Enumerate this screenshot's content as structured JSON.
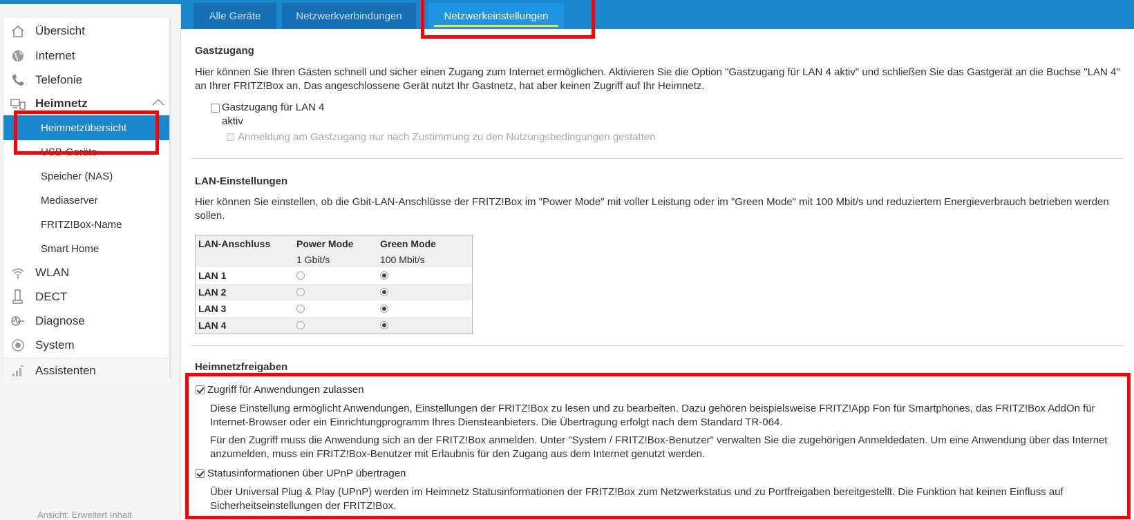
{
  "sidebar": {
    "items": [
      {
        "label": "Übersicht",
        "icon": "home-icon"
      },
      {
        "label": "Internet",
        "icon": "globe-icon"
      },
      {
        "label": "Telefonie",
        "icon": "phone-icon"
      },
      {
        "label": "Heimnetz",
        "icon": "network-icon"
      },
      {
        "label": "WLAN",
        "icon": "wifi-icon"
      },
      {
        "label": "DECT",
        "icon": "dect-phone-icon"
      },
      {
        "label": "Diagnose",
        "icon": "diagnose-icon"
      },
      {
        "label": "System",
        "icon": "system-icon"
      },
      {
        "label": "Assistenten",
        "icon": "wizard-icon"
      }
    ],
    "subitems": [
      "Heimnetzübersicht",
      "USB-Geräte",
      "Speicher (NAS)",
      "Mediaserver",
      "FRITZ!Box-Name",
      "Smart Home"
    ],
    "footer": "Ansicht: Erweitert   Inhalt"
  },
  "tabs": [
    "Alle Geräte",
    "Netzwerkverbindungen",
    "Netzwerkeinstellungen"
  ],
  "guest": {
    "title": "Gastzugang",
    "text": "Hier können Sie Ihren Gästen schnell und sicher einen Zugang zum Internet ermöglichen. Aktivieren Sie die Option \"Gastzugang für LAN 4 aktiv\" und schließen Sie das Gastgerät an die Buchse \"LAN 4\" an Ihrer FRITZ!Box an. Das angeschlossene Gerät nutzt Ihr Gastnetz, hat aber keinen Zugriff auf Ihr Heimnetz.",
    "cb1_line1": "Gastzugang für LAN 4",
    "cb1_line2": "aktiv",
    "cb2": "Anmeldung am Gastzugang nur nach Zustimmung zu den Nutzungsbedingungen gestatten"
  },
  "lan": {
    "title": "LAN-Einstellungen",
    "text": "Hier können Sie einstellen, ob die Gbit-LAN-Anschlüsse der FRITZ!Box im \"Power Mode\" mit voller Leistung oder im \"Green Mode\" mit 100 Mbit/s und reduziertem Energieverbrauch betrieben werden sollen.",
    "col_port": "LAN-Anschluss",
    "col_power": "Power Mode",
    "col_green": "Green Mode",
    "sub_power": "1 Gbit/s",
    "sub_green": "100 Mbit/s",
    "rows": [
      "LAN 1",
      "LAN 2",
      "LAN 3",
      "LAN 4"
    ],
    "selected": [
      "green",
      "green",
      "green",
      "green"
    ]
  },
  "share": {
    "title": "Heimnetzfreigaben",
    "cb1": "Zugriff für Anwendungen zulassen",
    "p1": "Diese Einstellung ermöglicht Anwendungen, Einstellungen der FRITZ!Box zu lesen und zu bearbeiten. Dazu gehören beispielsweise FRITZ!App Fon für Smartphones, das FRITZ!Box AddOn für Internet-Browser oder ein Einrichtungprogramm Ihres Diensteanbieters. Die Übertragung erfolgt nach dem Standard TR-064.",
    "p2": "Für den Zugriff muss die Anwendung sich an der FRITZ!Box anmelden. Unter \"System / FRITZ!Box-Benutzer\" verwalten Sie die zugehörigen Anmeldedaten. Um eine Anwendung über das Internet anzumelden, muss ein FRITZ!Box-Benutzer mit Erlaubnis für den Zugang aus dem Internet genutzt werden.",
    "cb2": "Statusinformationen über UPnP übertragen",
    "p3": "Über Universal Plug & Play (UPnP) werden im Heimnetz Statusinformationen der FRITZ!Box zum Netzwerkstatus und zu Portfreigaben bereitgestellt. Die Funktion hat keinen Einfluss auf Sicherheitseinstellungen der FRITZ!Box."
  },
  "colors": {
    "accent": "#1a86d0",
    "highlight": "#ff0000",
    "tab_underline": "#e8e63a"
  }
}
